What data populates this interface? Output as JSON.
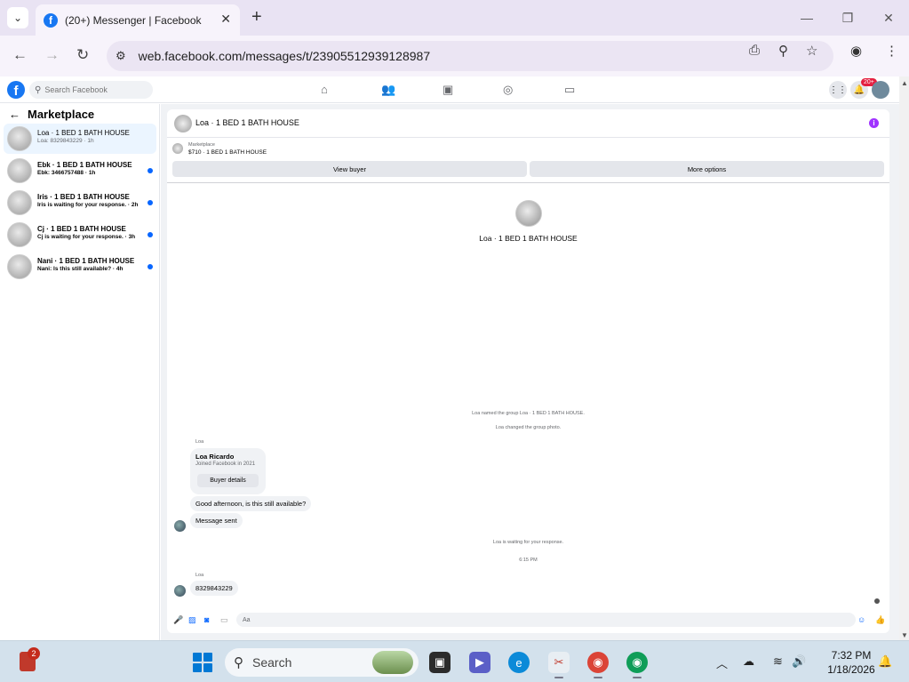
{
  "browser": {
    "tab_title": "(20+) Messenger | Facebook",
    "url": "web.facebook.com/messages/t/23905512939128987"
  },
  "fb": {
    "search_placeholder": "Search Facebook",
    "notifications_badge": "20+"
  },
  "sidebar": {
    "title": "Marketplace",
    "conversations": [
      {
        "name": "Loa · 1 BED 1 BATH HOUSE",
        "preview": "Loa: 8329843229 · 1h",
        "active": true,
        "unread": false
      },
      {
        "name": "Ebk · 1 BED 1 BATH HOUSE",
        "preview": "Ebk: 3466757488 · 1h",
        "active": false,
        "unread": true
      },
      {
        "name": "Iris · 1 BED 1 BATH HOUSE",
        "preview": "Iris is waiting for your response. · 2h",
        "active": false,
        "unread": true
      },
      {
        "name": "Cj · 1 BED 1 BATH HOUSE",
        "preview": "Cj is waiting for your response. · 3h",
        "active": false,
        "unread": true
      },
      {
        "name": "Nani · 1 BED 1 BATH HOUSE",
        "preview": "Nani: Is this still available? · 4h",
        "active": false,
        "unread": true
      }
    ]
  },
  "chat": {
    "title": "Loa · 1 BED 1 BATH HOUSE",
    "marketplace_label": "Marketplace",
    "listing": "$710 · 1 BED 1 BATH HOUSE",
    "view_buyer": "View buyer",
    "more_options": "More options",
    "hero_name": "Loa · 1 BED 1 BATH HOUSE",
    "sys_named": "Loa named the group Loa · 1 BED 1 BATH HOUSE.",
    "sys_photo": "Loa changed the group photo.",
    "sender1": "Loa",
    "card_name": "Loa Ricardo",
    "card_joined": "Joined Facebook in 2021",
    "card_button": "Buyer details",
    "msg1": "Good afternoon, is this still available?",
    "msg2": "Message sent",
    "sys_waiting": "Loa is waiting for your response.",
    "timestamp": "6:15 PM",
    "sender2": "Loa",
    "msg3": "8329843229",
    "composer_placeholder": "Aa"
  },
  "taskbar": {
    "widget_badge": "2",
    "search_text": "Search",
    "time": "7:32 PM",
    "date": "1/18/2026"
  }
}
